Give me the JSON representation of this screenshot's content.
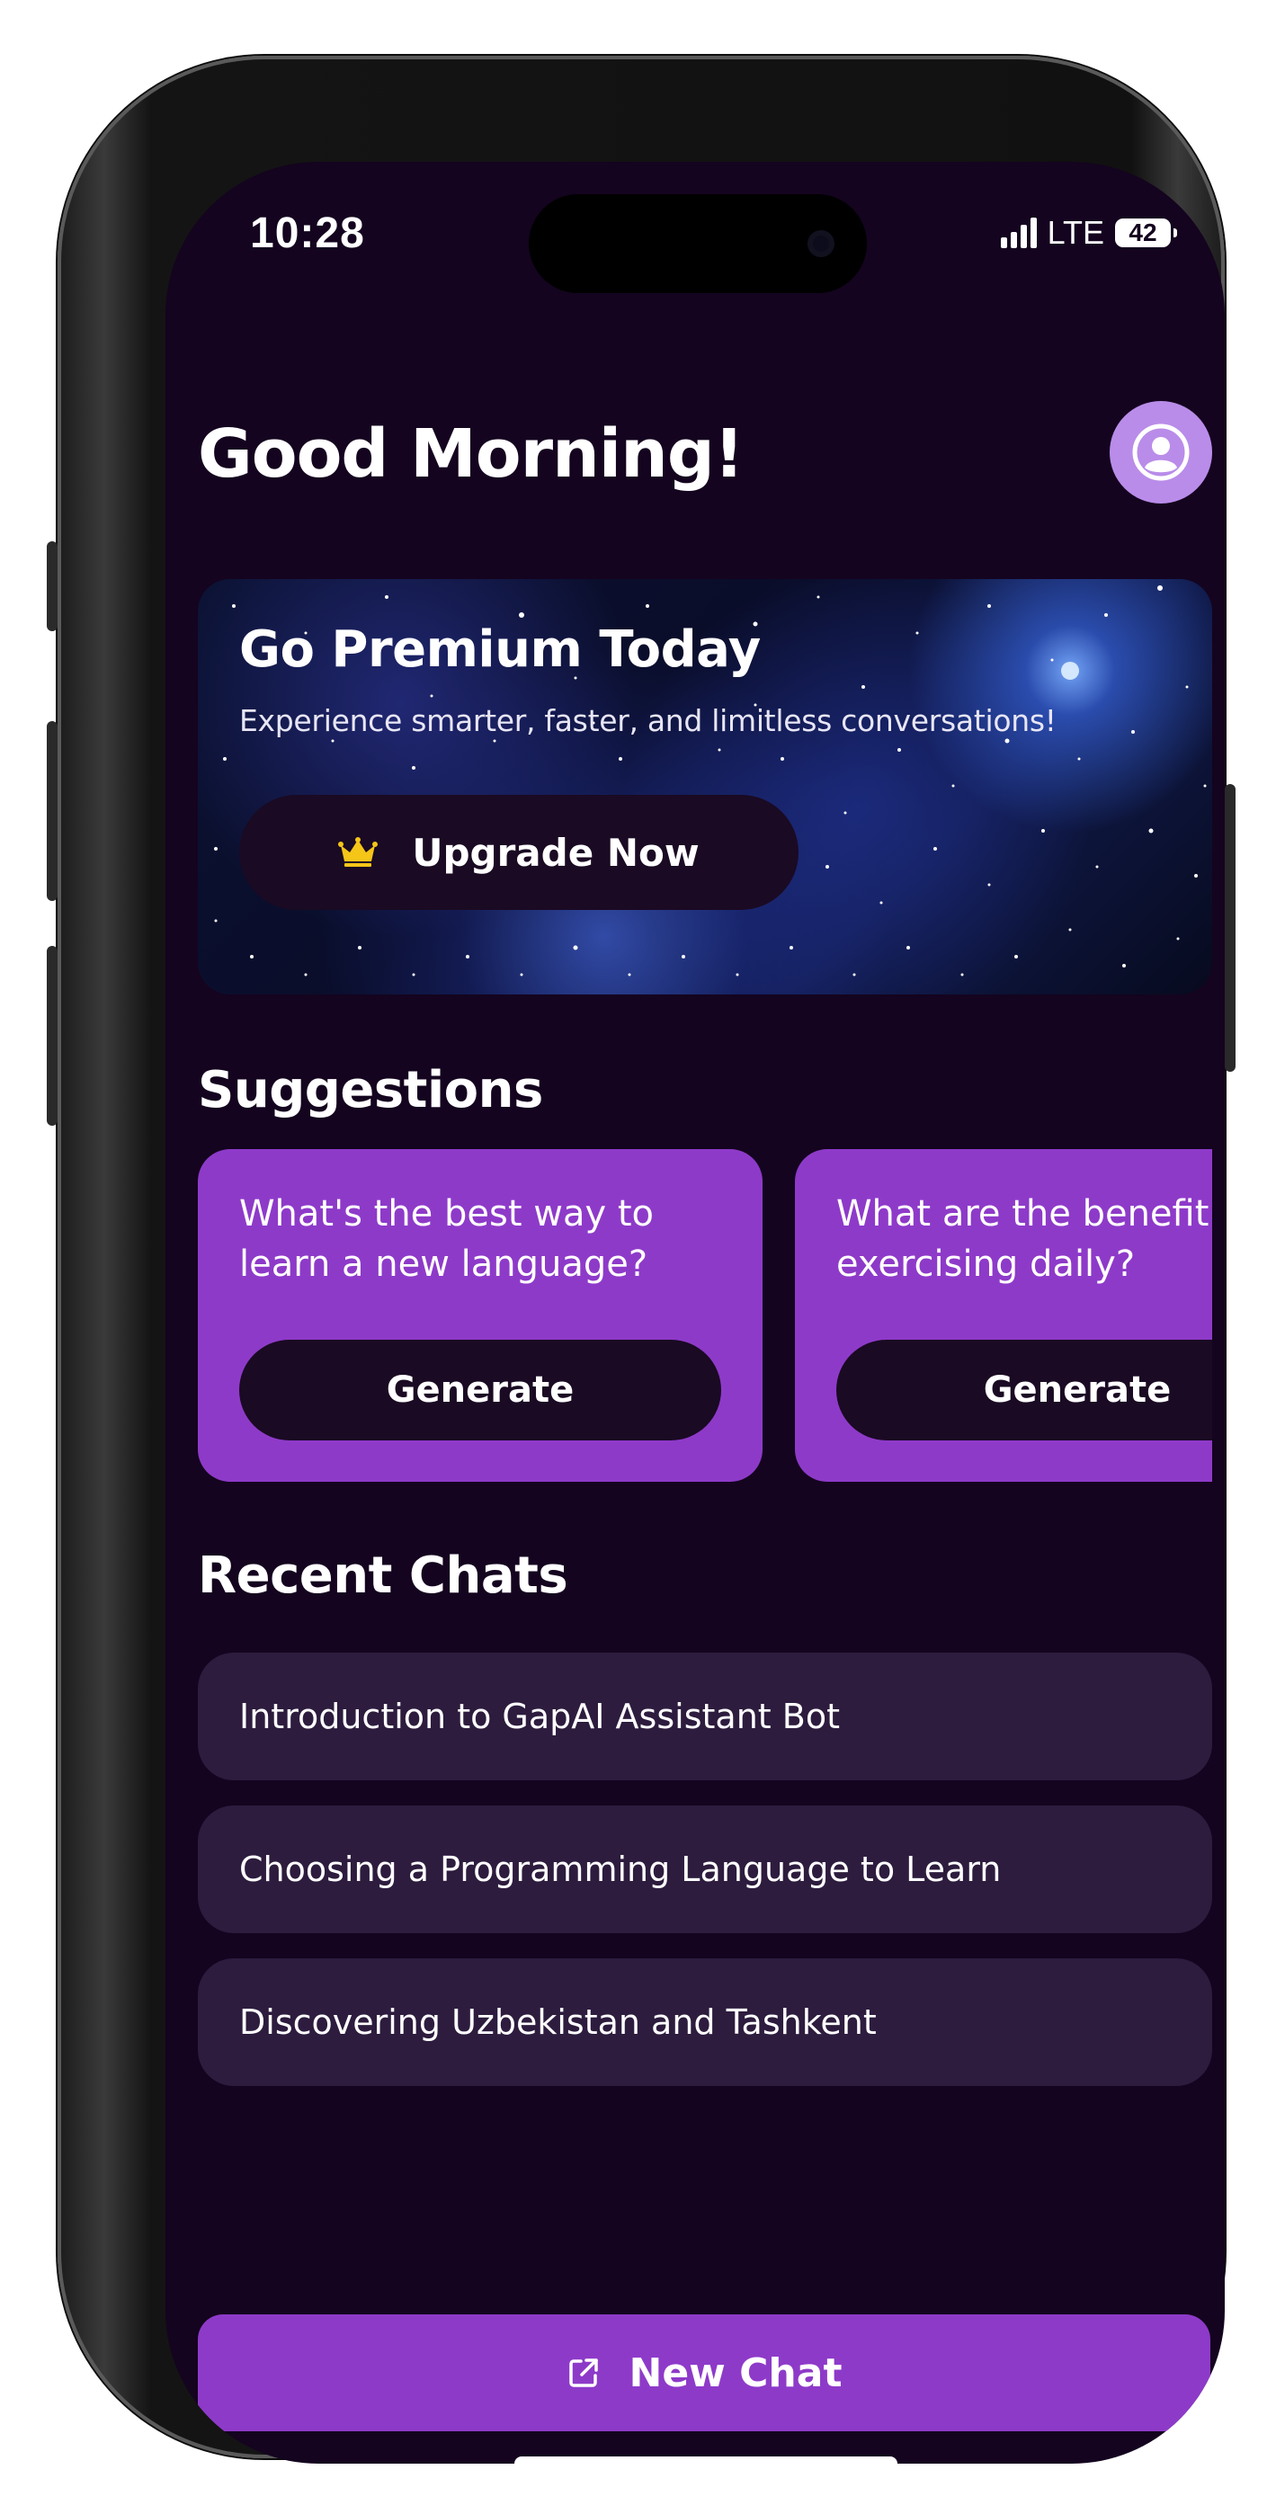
{
  "status_bar": {
    "time": "10:28",
    "network": "LTE",
    "battery": "42"
  },
  "header": {
    "greeting": "Good Morning!"
  },
  "premium": {
    "title": "Go Premium Today",
    "subtitle": "Experience smarter, faster, and limitless conversations!",
    "button_label": "Upgrade Now"
  },
  "suggestions": {
    "title": "Suggestions",
    "items": [
      {
        "text": "What's the best way to\nlearn a new language?",
        "button_label": "Generate"
      },
      {
        "text": "What are the benefit\nexercising daily?",
        "button_label": "Generate"
      }
    ]
  },
  "recent_chats": {
    "title": "Recent Chats",
    "items": [
      {
        "label": "Introduction to GapAI Assistant Bot"
      },
      {
        "label": "Choosing a Programming Language to Learn"
      },
      {
        "label": "Discovering Uzbekistan and Tashkent"
      }
    ]
  },
  "new_chat": {
    "label": "New Chat"
  },
  "colors": {
    "background": "#14041f",
    "accent": "#8e3ac9",
    "chat_item": "#2d1c3e",
    "avatar": "#b98ce9",
    "crown": "#f5c518"
  },
  "icons": {
    "avatar": "user-avatar-icon",
    "crown": "crown-icon",
    "new_chat": "external-link-icon"
  }
}
